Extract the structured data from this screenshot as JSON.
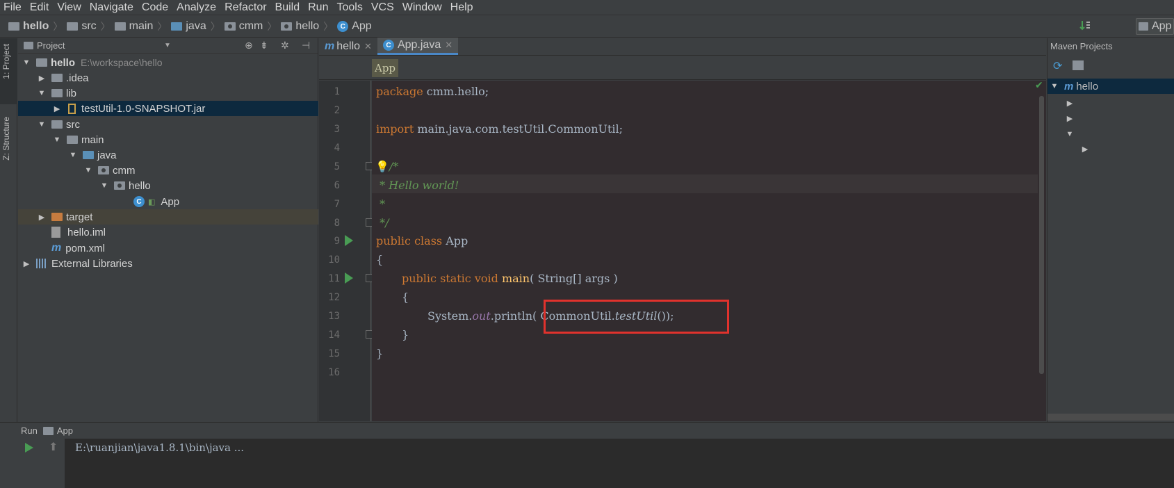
{
  "menu": [
    "File",
    "Edit",
    "View",
    "Navigate",
    "Code",
    "Analyze",
    "Refactor",
    "Build",
    "Run",
    "Tools",
    "VCS",
    "Window",
    "Help"
  ],
  "breadcrumbs": [
    "hello",
    "src",
    "main",
    "java",
    "cmm",
    "hello",
    "App"
  ],
  "navbar_right": {
    "config_label": "App"
  },
  "left_tabs": {
    "project": "1: Project",
    "structure": "Z: Structure"
  },
  "project_panel": {
    "title": "Project",
    "tree": [
      {
        "label": "hello",
        "path": "E:\\workspace\\hello",
        "bold": true
      },
      {
        "label": ".idea"
      },
      {
        "label": "lib"
      },
      {
        "label": "testUtil-1.0-SNAPSHOT.jar"
      },
      {
        "label": "src"
      },
      {
        "label": "main"
      },
      {
        "label": "java"
      },
      {
        "label": "cmm"
      },
      {
        "label": "hello"
      },
      {
        "label": "App"
      },
      {
        "label": "target"
      },
      {
        "label": "hello.iml"
      },
      {
        "label": "pom.xml"
      },
      {
        "label": "External Libraries"
      }
    ]
  },
  "editor_tabs": [
    {
      "label": "hello",
      "active": false
    },
    {
      "label": "App.java",
      "active": true
    }
  ],
  "editor_crumb": "App",
  "line_numbers": [
    "1",
    "2",
    "3",
    "4",
    "5",
    "6",
    "7",
    "8",
    "9",
    "10",
    "11",
    "12",
    "13",
    "14",
    "15",
    "16"
  ],
  "code": {
    "l1_kw": "package",
    "l1_rest": " cmm.hello;",
    "l3_kw": "import",
    "l3_rest": " main.java.com.testUtil.CommonUtil;",
    "l5": "/*",
    "l6": " * Hello world!",
    "l7": " *",
    "l8": " */",
    "l9_kw": "public class",
    "l9_rest": " App",
    "l10": "{",
    "l11_kw": "public static void",
    "l11_fn": "main",
    "l11_rest": "( String[] args )",
    "l12": "{",
    "l13_a": "System.",
    "l13_out": "out",
    "l13_b": ".println",
    "l13_c": "( CommonUtil.",
    "l13_fn": "testUtil",
    "l13_d": "());",
    "l14": "}",
    "l15": "}"
  },
  "maven": {
    "title": "Maven Projects",
    "root": "hello"
  },
  "run_panel": {
    "title": "Run",
    "config": "App",
    "console": "E:\\ruanjian\\java1.8.1\\bin\\java ..."
  },
  "colors": {
    "highlight_box": "#e0322d",
    "keyword": "#cc7832",
    "comment": "#629755",
    "selection": "#0d293e"
  }
}
